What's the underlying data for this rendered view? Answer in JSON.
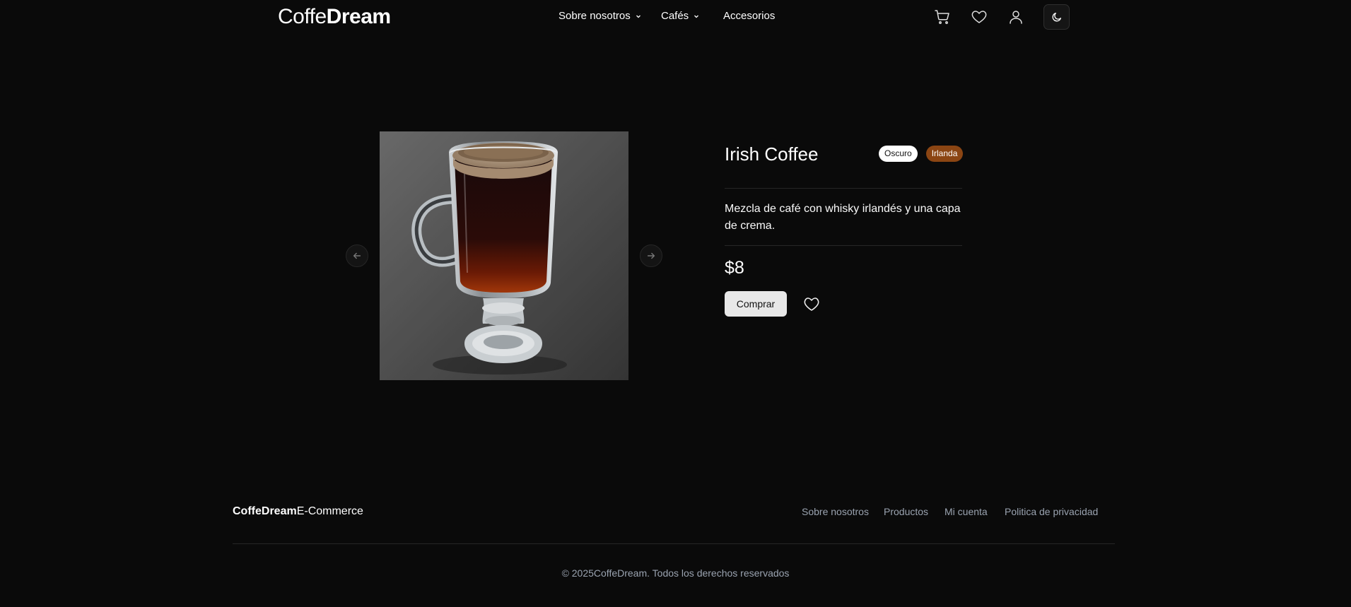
{
  "header": {
    "logo_light": "Coffe",
    "logo_bold": "Dream",
    "nav": [
      {
        "label": "Sobre nosotros",
        "has_dropdown": true
      },
      {
        "label": "Cafés",
        "has_dropdown": true
      },
      {
        "label": "Accesorios",
        "has_dropdown": false
      }
    ],
    "icons": [
      "cart-icon",
      "heart-icon",
      "user-icon",
      "moon-icon"
    ]
  },
  "product": {
    "image": "irish-coffee-photo",
    "title": "Irish Coffee",
    "badges": [
      "Oscuro",
      "Irlanda"
    ],
    "description": "Mezcla de café con whisky irlandés y una capa de crema.",
    "price": "$8",
    "buy_label": "Comprar"
  },
  "footer": {
    "brand_bold": "CoffeDream",
    "brand_light": "E-Commerce",
    "links": [
      "Sobre nosotros",
      "Productos",
      "Mi cuenta",
      "Politica de privacidad"
    ],
    "copyright": "© 2025CoffeDream. Todos los derechos reservados"
  },
  "colors": {
    "background": "#0a0a0a",
    "badge_brown": "#8b4513",
    "button_bg": "#e8e8e8",
    "muted_text": "#9aa3b0"
  }
}
